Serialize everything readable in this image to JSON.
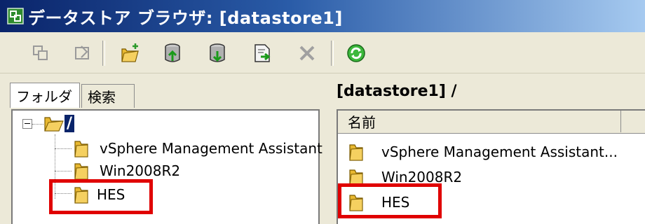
{
  "window": {
    "title": "データストア ブラウザ: [datastore1]"
  },
  "toolbar": {
    "buttons": [
      {
        "name": "copy-icon"
      },
      {
        "name": "move-icon"
      },
      {
        "name": "new-folder-icon"
      },
      {
        "name": "upload-icon"
      },
      {
        "name": "download-icon"
      },
      {
        "name": "register-icon"
      },
      {
        "name": "delete-icon"
      },
      {
        "name": "refresh-icon"
      }
    ]
  },
  "left_pane": {
    "tabs": [
      {
        "label": "フォルダ"
      },
      {
        "label": "検索"
      }
    ],
    "tree": {
      "root_label": "/",
      "items": [
        {
          "label": "vSphere Management Assistant"
        },
        {
          "label": "Win2008R2"
        },
        {
          "label": "HES"
        }
      ]
    }
  },
  "right_pane": {
    "path": "[datastore1] /",
    "columns": [
      {
        "label": "名前"
      }
    ],
    "rows": [
      {
        "label": "vSphere Management Assistant..."
      },
      {
        "label": "Win2008R2"
      },
      {
        "label": "HES"
      }
    ]
  },
  "colors": {
    "highlight": "#e00000",
    "folder": "#e8b830",
    "title_start": "#0a246a",
    "title_end": "#a6caf0"
  }
}
